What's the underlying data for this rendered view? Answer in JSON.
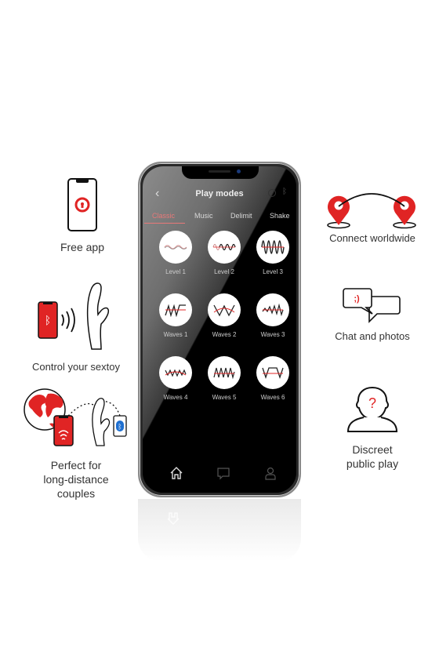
{
  "features": {
    "free_app": {
      "label": "Free app"
    },
    "control": {
      "label": "Control your sextoy"
    },
    "long_distance": {
      "label_lines": [
        "Perfect for",
        "long-distance",
        "couples"
      ]
    },
    "connect": {
      "label": "Connect worldwide"
    },
    "chat": {
      "label": "Chat and photos",
      "emoticon": ";)"
    },
    "discreet": {
      "label_lines": [
        "Discreet",
        "public play"
      ],
      "symbol": "?"
    }
  },
  "app": {
    "title": "Play modes",
    "back_icon": "chevron-left-icon",
    "tabs": [
      {
        "label": "Classic",
        "active": true
      },
      {
        "label": "Music",
        "active": false
      },
      {
        "label": "Delimit",
        "active": false
      },
      {
        "label": "Shake",
        "active": false
      }
    ],
    "modes": [
      {
        "label": "Level 1"
      },
      {
        "label": "Level 2"
      },
      {
        "label": "Level 3"
      },
      {
        "label": "Waves 1"
      },
      {
        "label": "Waves 2"
      },
      {
        "label": "Waves 3"
      },
      {
        "label": "Waves 4"
      },
      {
        "label": "Waves 5"
      },
      {
        "label": "Waves 6"
      }
    ],
    "nav": [
      "home-icon",
      "chat-icon",
      "profile-icon"
    ]
  },
  "colors": {
    "accent": "#e02424",
    "tab_active": "#e87878"
  }
}
